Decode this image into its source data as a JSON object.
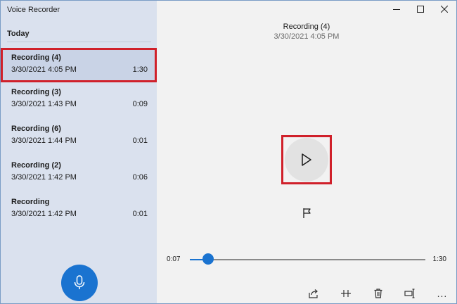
{
  "app": {
    "title": "Voice Recorder"
  },
  "sidebar": {
    "section_label": "Today",
    "items": [
      {
        "name": "Recording (4)",
        "date": "3/30/2021 4:05 PM",
        "duration": "1:30",
        "selected": true
      },
      {
        "name": "Recording (3)",
        "date": "3/30/2021 1:43 PM",
        "duration": "0:09"
      },
      {
        "name": "Recording (6)",
        "date": "3/30/2021 1:44 PM",
        "duration": "0:01"
      },
      {
        "name": "Recording (2)",
        "date": "3/30/2021 1:42 PM",
        "duration": "0:06"
      },
      {
        "name": "Recording",
        "date": "3/30/2021 1:42 PM",
        "duration": "0:01"
      }
    ],
    "record_icon": "microphone-icon"
  },
  "player": {
    "title": "Recording (4)",
    "date": "3/30/2021 4:05 PM",
    "current_time": "0:07",
    "total_time": "1:30",
    "progress": 0.078,
    "toolbar": [
      "share-icon",
      "trim-icon",
      "delete-icon",
      "rename-icon",
      "more-icon"
    ],
    "more_label": "..."
  },
  "colors": {
    "accent": "#1a73d0",
    "sidebar": "#dae1ee",
    "highlight_border": "#d0202a"
  }
}
